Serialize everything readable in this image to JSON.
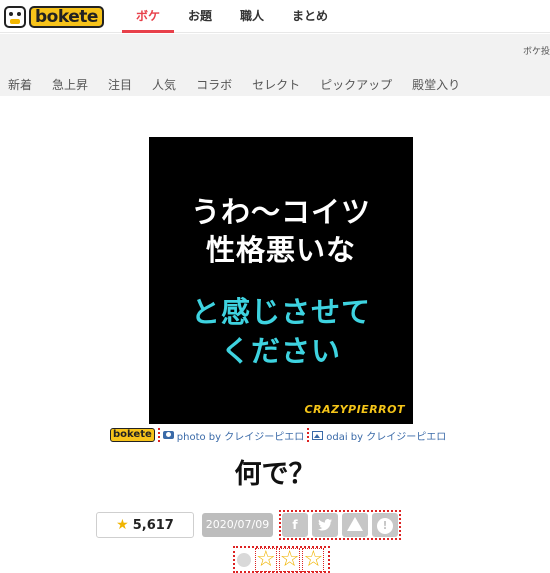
{
  "header": {
    "logo_text": "bokete",
    "nav": [
      {
        "label": "ボケ",
        "active": true
      },
      {
        "label": "お題",
        "active": false
      },
      {
        "label": "職人",
        "active": false
      },
      {
        "label": "まとめ",
        "active": false
      }
    ]
  },
  "subheader": {
    "right_text": "ボケ投",
    "tabs": [
      "新着",
      "急上昇",
      "注目",
      "人気",
      "コラボ",
      "セレクト",
      "ピックアップ",
      "殿堂入り"
    ]
  },
  "image": {
    "lines_white": [
      "うわ〜コイツ",
      "性格悪いな"
    ],
    "lines_cyan": [
      "と感じさせて",
      "ください"
    ],
    "brand": "CRAZYPIERROT",
    "background": "#000000",
    "text_cyan": "#3ed3e0"
  },
  "credits": {
    "logo": "bokete",
    "photo_label": "photo by クレイジーピエロ",
    "odai_label": "odai by クレイジーピエロ"
  },
  "caption": "何で？",
  "actions": {
    "rating_count": "5,617",
    "date": "2020/07/09",
    "share_icons": [
      "facebook-icon",
      "twitter-icon",
      "warning-icon",
      "info-icon"
    ]
  },
  "colors": {
    "accent": "#e8404a",
    "star": "#f0b400"
  }
}
